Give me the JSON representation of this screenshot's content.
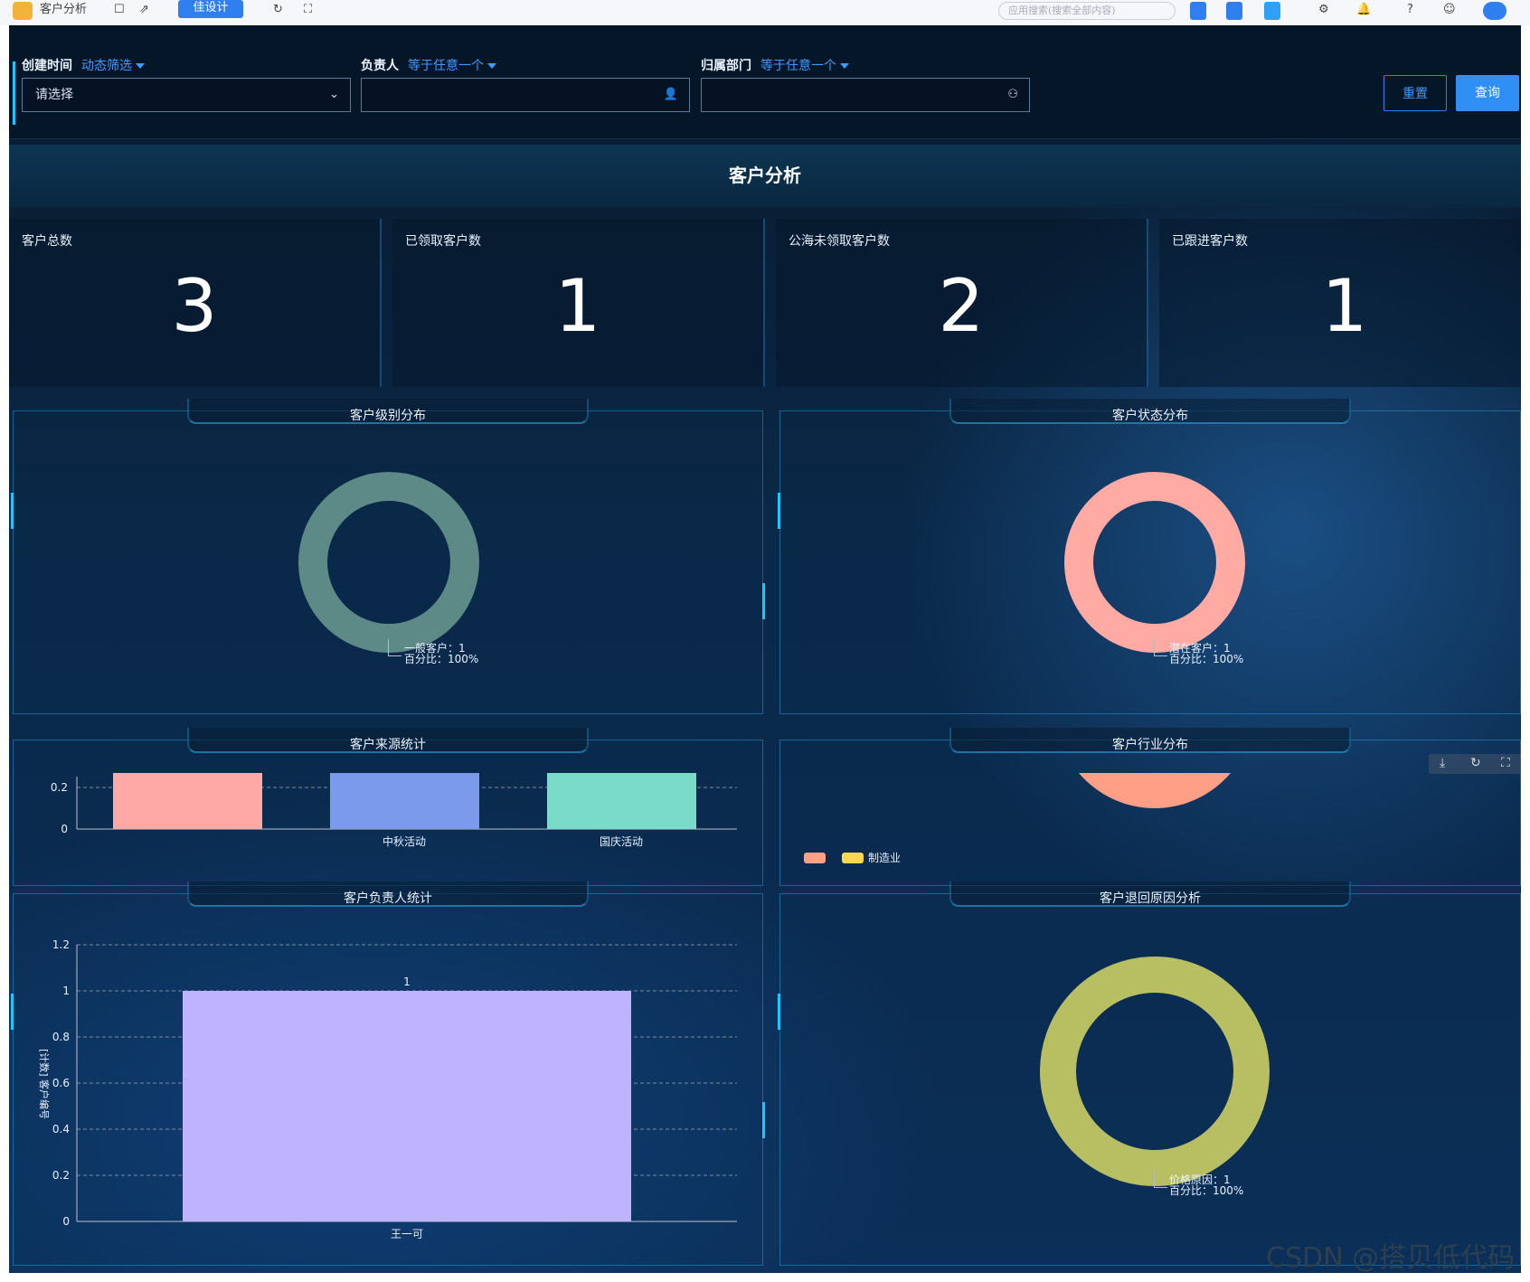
{
  "toolbar": {
    "title": "客户分析",
    "design_label": "佳设计",
    "search_placeholder": "应用搜索(搜索全部内容)"
  },
  "filters": {
    "created_time": {
      "label": "创建时间",
      "mode": "动态筛选",
      "placeholder": "请选择"
    },
    "owner": {
      "label": "负责人",
      "mode": "等于任意一个",
      "value": ""
    },
    "department": {
      "label": "归属部门",
      "mode": "等于任意一个",
      "value": ""
    },
    "reset_label": "重置",
    "query_label": "查询"
  },
  "page_title": "客户分析",
  "stats": [
    {
      "label": "客户总数",
      "value": "3"
    },
    {
      "label": "已领取客户数",
      "value": "1"
    },
    {
      "label": "公海未领取客户数",
      "value": "2"
    },
    {
      "label": "已跟进客户数",
      "value": "1"
    }
  ],
  "panels": {
    "level": {
      "title": "客户级别分布",
      "tip_name": "一般客户：1",
      "tip_pct": "百分比：100%"
    },
    "status": {
      "title": "客户状态分布",
      "tip_name": "潜在客户：1",
      "tip_pct": "百分比：100%"
    },
    "source": {
      "title": "客户来源统计"
    },
    "industry": {
      "title": "客户行业分布",
      "legend_label": "制造业"
    },
    "owner": {
      "title": "客户负责人统计",
      "y_label": "[计数] 客户编号",
      "bar_label": "1"
    },
    "return": {
      "title": "客户退回原因分析",
      "tip_name": "价格原因：1",
      "tip_pct": "百分比：100%"
    }
  },
  "chart_data": [
    {
      "type": "pie",
      "title": "客户级别分布",
      "categories": [
        "一般客户"
      ],
      "values": [
        1
      ],
      "colors": [
        "#5d8a86"
      ],
      "donut": true
    },
    {
      "type": "pie",
      "title": "客户状态分布",
      "categories": [
        "潜在客户"
      ],
      "values": [
        1
      ],
      "colors": [
        "#ffaba4"
      ],
      "donut": true
    },
    {
      "type": "bar",
      "title": "客户来源统计",
      "categories": [
        "",
        "中秋活动",
        "国庆活动"
      ],
      "values": [
        1,
        1,
        1
      ],
      "yticks": [
        "0",
        "0.2"
      ],
      "colors": [
        "#ffa9a6",
        "#7b9aec",
        "#79dbc8"
      ]
    },
    {
      "type": "pie",
      "title": "客户行业分布",
      "categories": [
        "",
        "制造业"
      ],
      "colors": [
        "#ff9f86",
        "#ffd84d"
      ]
    },
    {
      "type": "bar",
      "title": "客户负责人统计",
      "categories": [
        "王一可"
      ],
      "values": [
        1
      ],
      "ylim": [
        0,
        1.2
      ],
      "yticks": [
        "0",
        "0.2",
        "0.4",
        "0.6",
        "0.8",
        "1",
        "1.2"
      ],
      "ylabel": "[计数] 客户编号",
      "grid": true,
      "colors": [
        "#bfb3ff"
      ]
    },
    {
      "type": "pie",
      "title": "客户退回原因分析",
      "categories": [
        "价格原因"
      ],
      "values": [
        1
      ],
      "colors": [
        "#b8bf63"
      ],
      "donut": true
    }
  ],
  "watermark": "CSDN @搭贝低代码"
}
